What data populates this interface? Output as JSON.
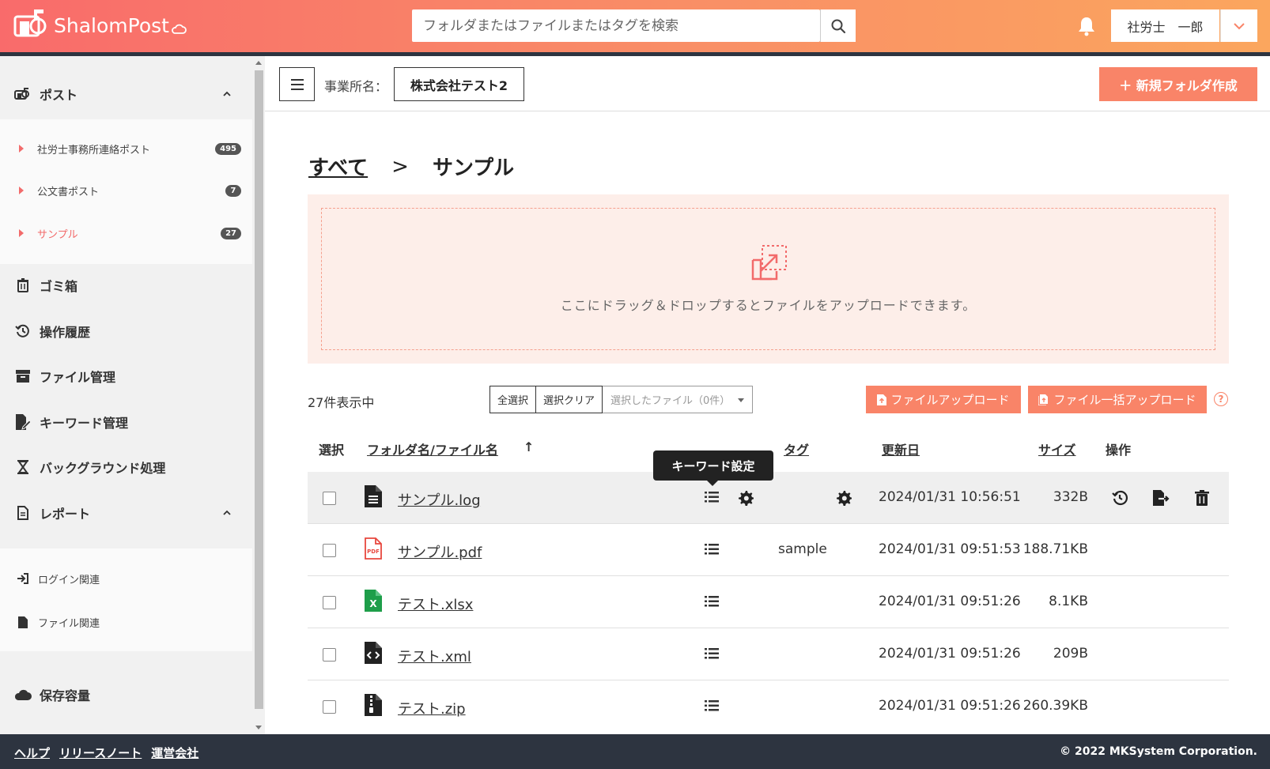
{
  "app": {
    "logo_text": "ShalomPost"
  },
  "header": {
    "search_placeholder": "フォルダまたはファイルまたはタグを検索",
    "user_name": "社労士　一郎"
  },
  "colors": {
    "accent": "#f98468",
    "header_start": "#f96b6b",
    "header_end": "#fba65e",
    "dark": "#2d3440",
    "active": "#f26b6b"
  },
  "sidebar": {
    "post_section": {
      "label": "ポスト"
    },
    "post_items": [
      {
        "label": "社労士事務所連絡ポスト",
        "badge": "495"
      },
      {
        "label": "公文書ポスト",
        "badge": "7"
      },
      {
        "label": "サンプル",
        "badge": "27"
      }
    ],
    "sections": [
      {
        "label": "ゴミ箱"
      },
      {
        "label": "操作履歴"
      },
      {
        "label": "ファイル管理"
      },
      {
        "label": "キーワード管理"
      },
      {
        "label": "バックグラウンド処理"
      }
    ],
    "report_section": {
      "label": "レポート"
    },
    "report_items": [
      {
        "label": "ログイン関連"
      },
      {
        "label": "ファイル関連"
      }
    ],
    "storage": {
      "label": "保存容量"
    }
  },
  "topbar": {
    "business_label": "事業所名：",
    "business_name": "株式会社テスト2",
    "new_folder_label": "＋ 新規フォルダ作成"
  },
  "breadcrumb": {
    "root": "すべて",
    "sep": ">",
    "current": "サンプル"
  },
  "dropzone": {
    "text": "ここにドラッグ＆ドロップするとファイルをアップロードできます。"
  },
  "toolbar": {
    "count": "27件表示中",
    "select_all": "全選択",
    "select_clear": "選択クリア",
    "selected_files": "選択したファイル（0件）",
    "upload": "ファイルアップロード",
    "bulk_upload": "ファイル一括アップロード",
    "help": "?"
  },
  "table": {
    "headers": {
      "select": "選択",
      "name": "フォルダ名/ファイル名",
      "sort_arrow": "↑",
      "tag": "タグ",
      "updated": "更新日",
      "size": "サイズ",
      "ops": "操作"
    },
    "tooltip": "キーワード設定",
    "rows": [
      {
        "name": "サンプル.log",
        "icon": "file-text-icon",
        "tag": "",
        "date": "2024/01/31 10:56:51",
        "size": "332B"
      },
      {
        "name": "サンプル.pdf",
        "icon": "pdf-icon",
        "tag": "sample",
        "date": "2024/01/31 09:51:53",
        "size": "188.71KB"
      },
      {
        "name": "テスト.xlsx",
        "icon": "excel-icon",
        "tag": "",
        "date": "2024/01/31 09:51:26",
        "size": "8.1KB"
      },
      {
        "name": "テスト.xml",
        "icon": "code-file-icon",
        "tag": "",
        "date": "2024/01/31 09:51:26",
        "size": "209B"
      },
      {
        "name": "テスト.zip",
        "icon": "zip-icon",
        "tag": "",
        "date": "2024/01/31 09:51:26",
        "size": "260.39KB"
      }
    ]
  },
  "footer": {
    "links": [
      "ヘルプ",
      "リリースノート",
      "運営会社"
    ],
    "copyright": "© 2022 MKSystem Corporation."
  }
}
